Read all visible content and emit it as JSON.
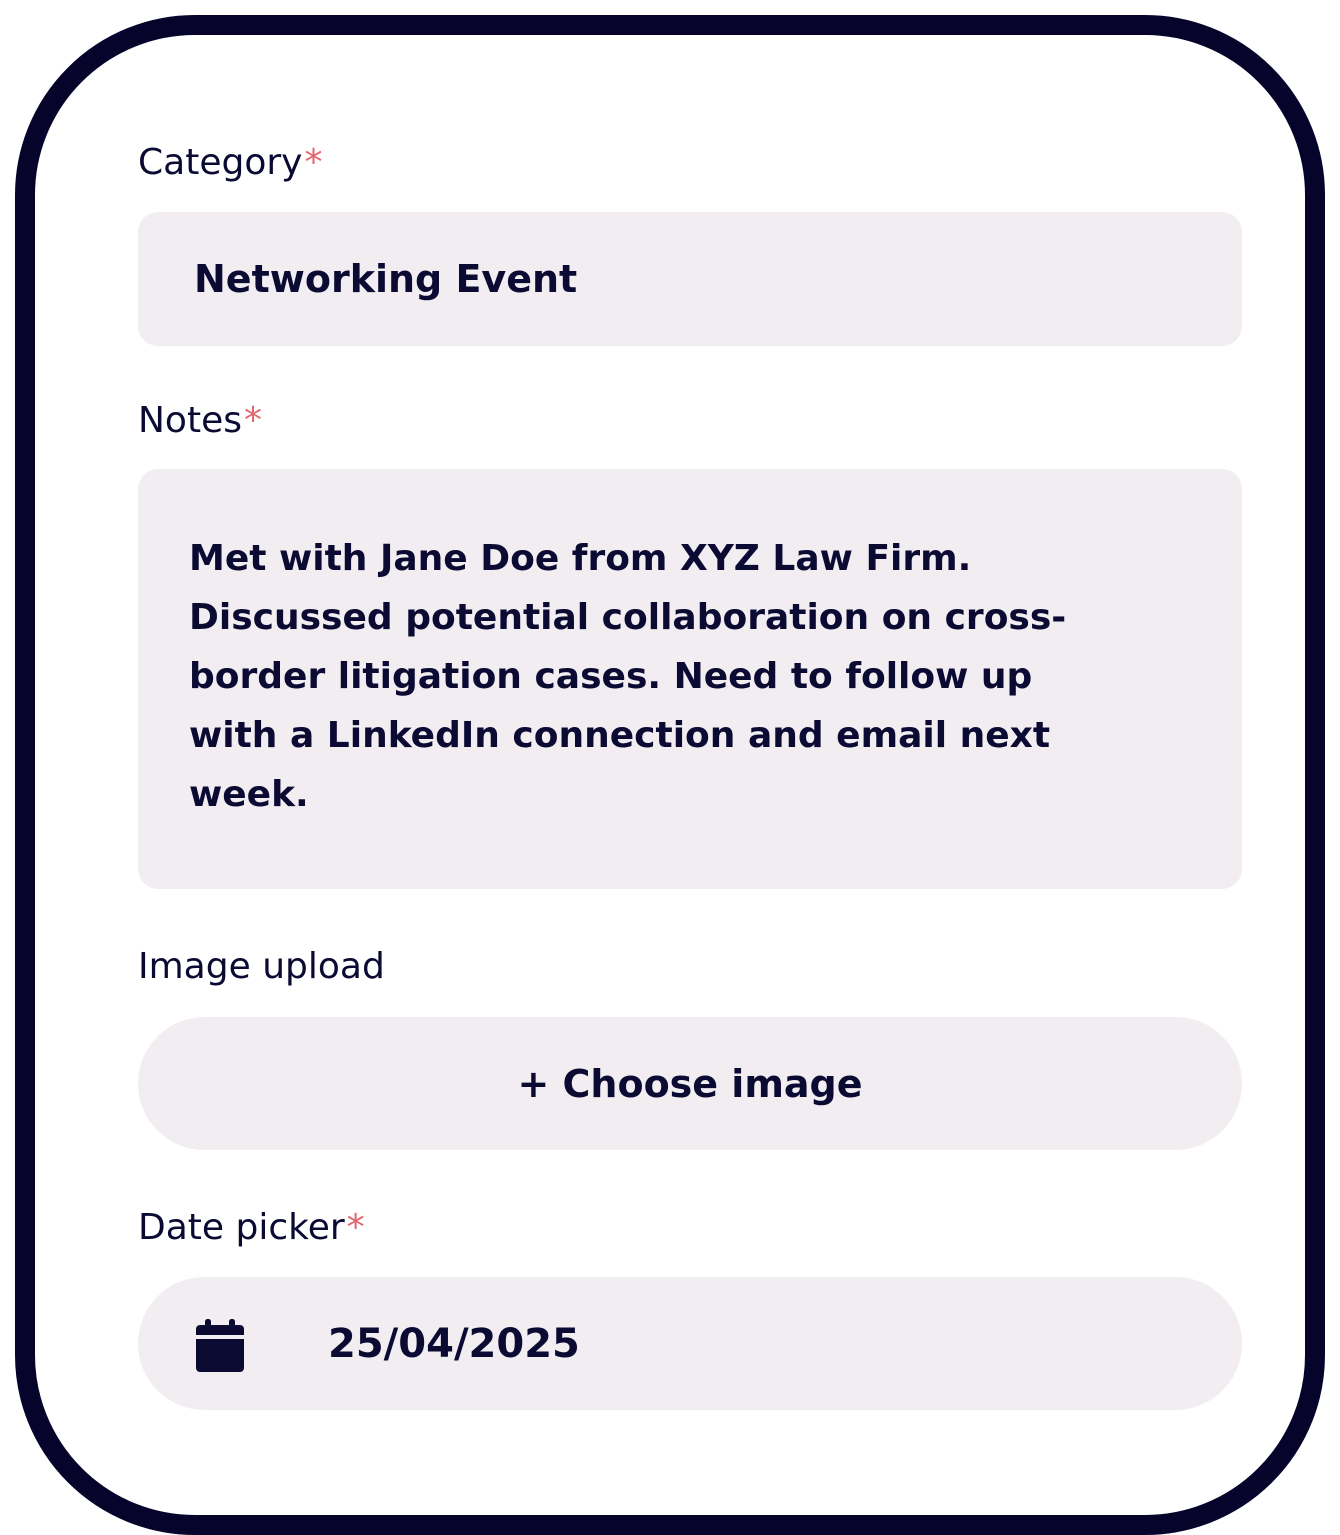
{
  "form": {
    "category": {
      "label": "Category",
      "required_mark": "*",
      "value": "Networking Event"
    },
    "notes": {
      "label": "Notes",
      "required_mark": "*",
      "value": "Met with Jane Doe from XYZ Law Firm. Discussed potential collaboration on cross-border litigation cases. Need to follow up with a LinkedIn connection and email next week."
    },
    "image_upload": {
      "label": "Image upload",
      "button_label": "+ Choose image"
    },
    "date_picker": {
      "label": "Date picker",
      "required_mark": "*",
      "icon": "calendar-icon",
      "value": "25/04/2025"
    }
  },
  "colors": {
    "frame": "#06042b",
    "text": "#0b0a33",
    "required": "#e06670",
    "field_bg": "#f1edf1",
    "background": "#ffffff"
  }
}
